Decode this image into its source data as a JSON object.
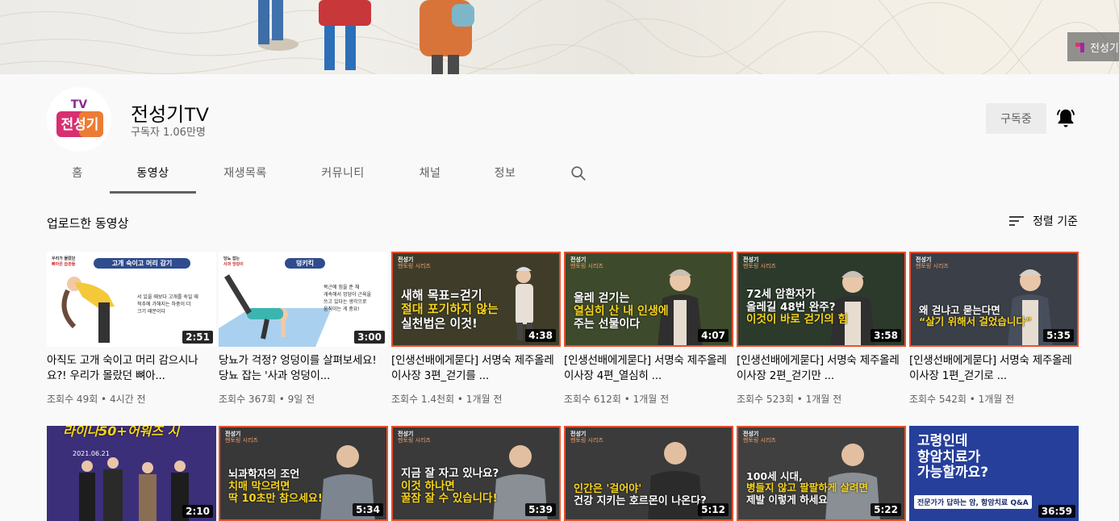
{
  "banner": {
    "badge_text": "전성기"
  },
  "channel": {
    "name": "전성기TV",
    "subscribers": "구독자 1.06만명",
    "subscribe_label": "구독중",
    "avatar_top": "TV",
    "avatar_text": "전성기"
  },
  "tabs": [
    "홈",
    "동영상",
    "재생목록",
    "커뮤니티",
    "채널",
    "정보"
  ],
  "section": {
    "title": "업로드한 동영상",
    "sort_label": "정렬 기준"
  },
  "videos_row1": [
    {
      "title": "아직도 고개 숙이고 머리 감으시나요?! 우리가 몰랐던 뼈아...",
      "meta": "조회수 49회 • 4시간 전",
      "duration": "2:51",
      "thumb_tag": "고개 숙이고 머리 감기",
      "thumb_lines": [
        "서 있을 때보다 고개를 숙일 때",
        "척추에 가해지는 하중이 더",
        "크기 때문이다"
      ],
      "thumb_corner": [
        "우리가 몰랐던",
        "뼈아픈 습관들"
      ]
    },
    {
      "title": "당뇨가 걱정? 엉덩이를 살펴보세요! 당뇨 잡는 '사과 엉덩이...",
      "meta": "조회수 367회 • 9일 전",
      "duration": "3:00",
      "thumb_tag": "덩키킥",
      "thumb_lines": [
        "복근에 힘을 준 채",
        "개속해서 엉덩이 근육을",
        "쓰고 있다는 생각으로",
        "움직이는 게 중요!"
      ],
      "thumb_corner": [
        "당뇨 잡는",
        "사과 엉덩이"
      ]
    },
    {
      "title": "[인생선배에게묻다] 서명숙 제주올레 이사장 3편_걷기를 ...",
      "meta": "조회수 1.4천회 • 1개월 전",
      "duration": "4:38",
      "thumb_lines": [
        "새해 목표=걷기",
        "절대 포기하지 않는",
        "실천법은 이것!"
      ]
    },
    {
      "title": "[인생선배에게묻다] 서명숙 제주올레 이사장 4편_열심히 ...",
      "meta": "조회수 612회 • 1개월 전",
      "duration": "4:07",
      "thumb_lines": [
        "올레 걷기는",
        "열심히 산 내 인생에",
        "주는 선물이다"
      ]
    },
    {
      "title": "[인생선배에게묻다] 서명숙 제주올레 이사장 2편_걷기만 ...",
      "meta": "조회수 523회 • 1개월 전",
      "duration": "3:58",
      "thumb_lines": [
        "72세 암환자가",
        "올레길 48번 완주?",
        "이것이 바로 걷기의 힘"
      ]
    },
    {
      "title": "[인생선배에게묻다] 서명숙 제주올레 이사장 1편_걷기로 ...",
      "meta": "조회수 542회 • 1개월 전",
      "duration": "5:35",
      "thumb_lines": [
        "왜 걷냐고 묻는다면",
        "“살기 위해서 걸었습니다”"
      ]
    }
  ],
  "series_tag": {
    "brand": "전성기",
    "sub": "멘토링 시리즈"
  },
  "videos_row2": [
    {
      "duration": "2:10",
      "thumb_lines": [
        "라이나50+어워즈 시",
        "2021.06.21"
      ]
    },
    {
      "duration": "5:34",
      "thumb_lines": [
        "뇌과학자의 조언",
        "치매 막으려면",
        "딱 10초만 참으세요!"
      ]
    },
    {
      "duration": "5:39",
      "thumb_lines": [
        "지금 잘 자고 있나요?",
        "이것 하나면",
        "꿀잠 잘 수 있습니다!"
      ]
    },
    {
      "duration": "5:12",
      "thumb_lines": [
        "인간은 '걸어야'",
        "건강 지키는 호르몬이 나온다?"
      ]
    },
    {
      "duration": "5:22",
      "thumb_lines": [
        "100세 시대,",
        "병들지 않고 팔팔하게 살려면",
        "제발 이렇게 하세요"
      ]
    },
    {
      "duration": "36:59",
      "thumb_lines": [
        "고령인데",
        "항암치료가",
        "가능할까요?",
        "전문가가 답하는 암, 항암치료 Q&A"
      ]
    }
  ],
  "colors": {
    "accent_red": "#e8502e",
    "thumb_yellow": "#f7d51d",
    "brand_pink": "#e22f6d",
    "brand_purple": "#9c2aa3"
  }
}
